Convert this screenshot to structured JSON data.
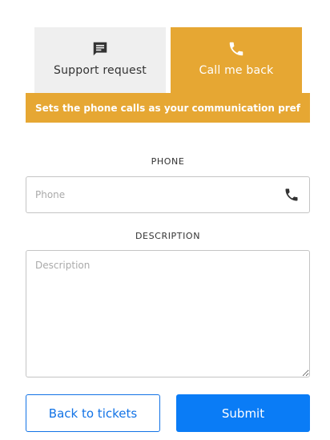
{
  "tabs": {
    "support": {
      "label": "Support request",
      "icon": "chat-icon"
    },
    "call": {
      "label": "Call me back",
      "icon": "phone-icon"
    }
  },
  "banner": {
    "text": "Sets the phone calls as your communication pref"
  },
  "form": {
    "phone_label": "PHONE",
    "phone_placeholder": "Phone",
    "phone_value": "",
    "description_label": "DESCRIPTION",
    "description_placeholder": "Description",
    "description_value": ""
  },
  "buttons": {
    "back_label": "Back to tickets",
    "submit_label": "Submit"
  },
  "colors": {
    "accent": "#e6a733",
    "inactive_tab": "#efefef",
    "primary": "#0a7cf6",
    "outline": "#1273e6"
  }
}
